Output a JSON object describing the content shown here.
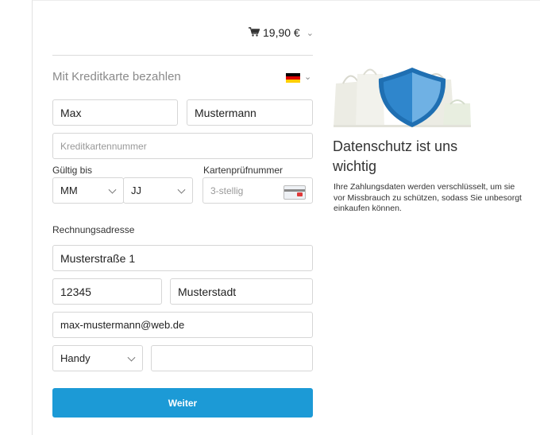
{
  "cart": {
    "icon": "cart-icon",
    "amount": "19,90 €"
  },
  "payment": {
    "method_title": "Mit Kreditkarte bezahlen",
    "flag_icon": "germany-flag-icon"
  },
  "name": {
    "first": "Max",
    "last": "Mustermann"
  },
  "card": {
    "number_placeholder": "Kreditkartennummer",
    "expiry_label": "Gültig bis",
    "month": "MM",
    "year": "JJ",
    "cvc_label": "Kartenprüfnummer",
    "cvc_placeholder": "3-stellig",
    "cvc_icon": "credit-card-icon"
  },
  "address": {
    "label": "Rechnungsadresse",
    "street": "Musterstraße 1",
    "zip": "12345",
    "city": "Musterstadt",
    "email": "max-mustermann@web.de",
    "phone_type": "Handy",
    "phone": ""
  },
  "submit_label": "Weiter",
  "privacy": {
    "illustration": "shield-shopping-bags-illustration",
    "title": "Datenschutz ist uns wichtig",
    "text": "Ihre Zahlungsdaten werden verschlüsselt, um sie vor Missbrauch zu schützen, sodass Sie unbesorgt einkaufen können."
  },
  "colors": {
    "accent": "#1c9ad6",
    "shield_dark": "#1f6fb2",
    "shield_light": "#6fb1e4"
  }
}
